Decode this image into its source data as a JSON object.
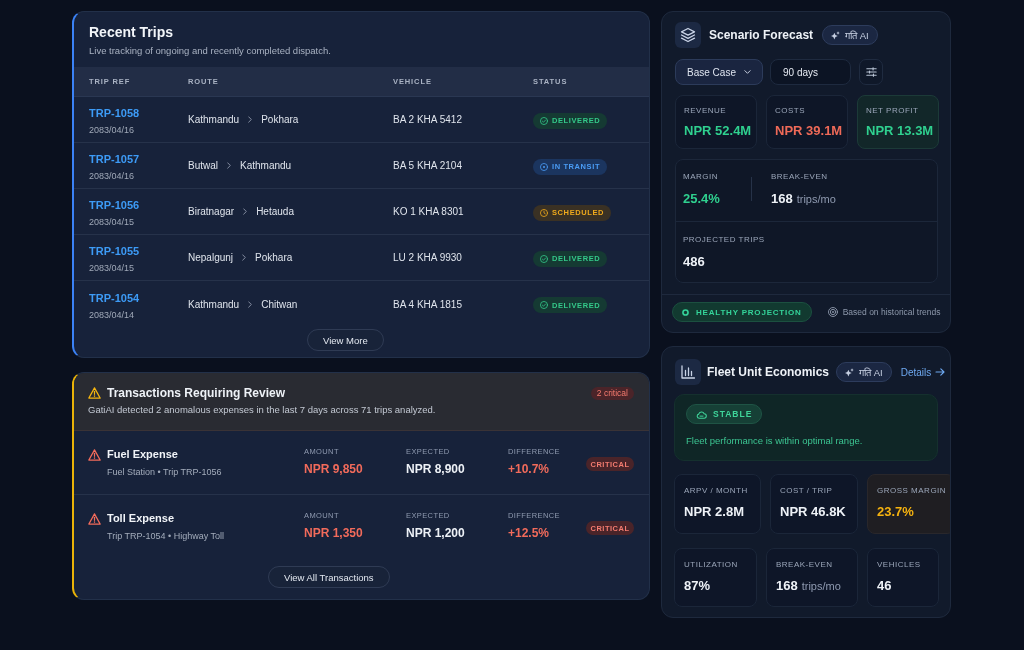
{
  "recent_trips": {
    "title": "Recent Trips",
    "subtitle": "Live tracking of ongoing and recently completed dispatch.",
    "columns": [
      "TRIP REF",
      "ROUTE",
      "VEHICLE",
      "STATUS"
    ],
    "rows": [
      {
        "ref": "TRP-1058",
        "date": "2083/04/16",
        "from": "Kathmandu",
        "to": "Pokhara",
        "vehicle": "BA 2 KHA 5412",
        "status": {
          "kind": "delivered",
          "label": "DELIVERED"
        }
      },
      {
        "ref": "TRP-1057",
        "date": "2083/04/16",
        "from": "Butwal",
        "to": "Kathmandu",
        "vehicle": "BA 5 KHA 2104",
        "status": {
          "kind": "in_transit",
          "label": "IN TRANSIT"
        }
      },
      {
        "ref": "TRP-1056",
        "date": "2083/04/15",
        "from": "Biratnagar",
        "to": "Hetauda",
        "vehicle": "KO 1 KHA 8301",
        "status": {
          "kind": "scheduled",
          "label": "SCHEDULED"
        }
      },
      {
        "ref": "TRP-1055",
        "date": "2083/04/15",
        "from": "Nepalgunj",
        "to": "Pokhara",
        "vehicle": "LU 2 KHA 9930",
        "status": {
          "kind": "delivered",
          "label": "DELIVERED"
        }
      },
      {
        "ref": "TRP-1054",
        "date": "2083/04/14",
        "from": "Kathmandu",
        "to": "Chitwan",
        "vehicle": "BA 4 KHA 1815",
        "status": {
          "kind": "delivered",
          "label": "DELIVERED"
        }
      }
    ],
    "view_more": "View More"
  },
  "transactions_review": {
    "title": "Transactions Requiring Review",
    "critical_count": "2 critical",
    "summary": "GatiAI detected 2 anomalous expenses in the last 7 days across 71 trips analyzed.",
    "items": [
      {
        "title": "Fuel Expense",
        "details": "Fuel Station • Trip TRP-1056",
        "amount_label": "AMOUNT",
        "amount": "NPR 9,850",
        "expected_label": "EXPECTED",
        "expected": "NPR 8,900",
        "difference_label": "DIFFERENCE",
        "difference": "+10.7%",
        "severity": "CRITICAL"
      },
      {
        "title": "Toll Expense",
        "details": "Trip TRP-1054 • Highway Toll",
        "amount_label": "AMOUNT",
        "amount": "NPR 1,350",
        "expected_label": "EXPECTED",
        "expected": "NPR 1,200",
        "difference_label": "DIFFERENCE",
        "difference": "+12.5%",
        "severity": "CRITICAL"
      }
    ],
    "view_all": "View All Transactions"
  },
  "scenario_forecast": {
    "title": "Scenario Forecast",
    "ai_badge": "गति AI",
    "scenario_select": "Base Case",
    "horizon_field": "90 days",
    "metrics": [
      {
        "label": "REVENUE",
        "value": "NPR 52.4M",
        "kind": "positive",
        "highlighted": false
      },
      {
        "label": "COSTS",
        "value": "NPR 39.1M",
        "kind": "negative",
        "highlighted": false
      },
      {
        "label": "NET PROFIT",
        "value": "NPR 13.3M",
        "kind": "positive",
        "highlighted": true
      }
    ],
    "summary": [
      {
        "label": "MARGIN",
        "value": "25.4%",
        "kind": "positive"
      },
      {
        "label": "BREAK-EVEN",
        "value": "168",
        "unit": "trips/mo",
        "kind": "neutral"
      }
    ],
    "projected": {
      "label": "PROJECTED TRIPS",
      "value": "486"
    },
    "health_badge": "HEALTHY PROJECTION",
    "note": "Based on historical trends"
  },
  "fleet_unit_economics": {
    "title": "Fleet Unit Economics",
    "ai_badge": "गति AI",
    "details_link": "Details",
    "status": {
      "label": "STABLE",
      "message": "Fleet performance is within optimal range."
    },
    "metrics": [
      {
        "label": "ARPV / MONTH",
        "value": "NPR 2.8M",
        "kind": "neutral",
        "highlighted": false
      },
      {
        "label": "COST / TRIP",
        "value": "NPR 46.8K",
        "kind": "neutral",
        "highlighted": false
      },
      {
        "label": "GROSS MARGIN",
        "value": "23.7%",
        "kind": "warning",
        "highlighted": true
      },
      {
        "label": "UTILIZATION",
        "value": "87%",
        "kind": "neutral",
        "highlighted": false
      },
      {
        "label": "BREAK-EVEN",
        "value": "168",
        "unit": "trips/mo",
        "kind": "neutral",
        "highlighted": false
      },
      {
        "label": "VEHICLES",
        "value": "46",
        "kind": "neutral",
        "highlighted": false
      }
    ]
  }
}
